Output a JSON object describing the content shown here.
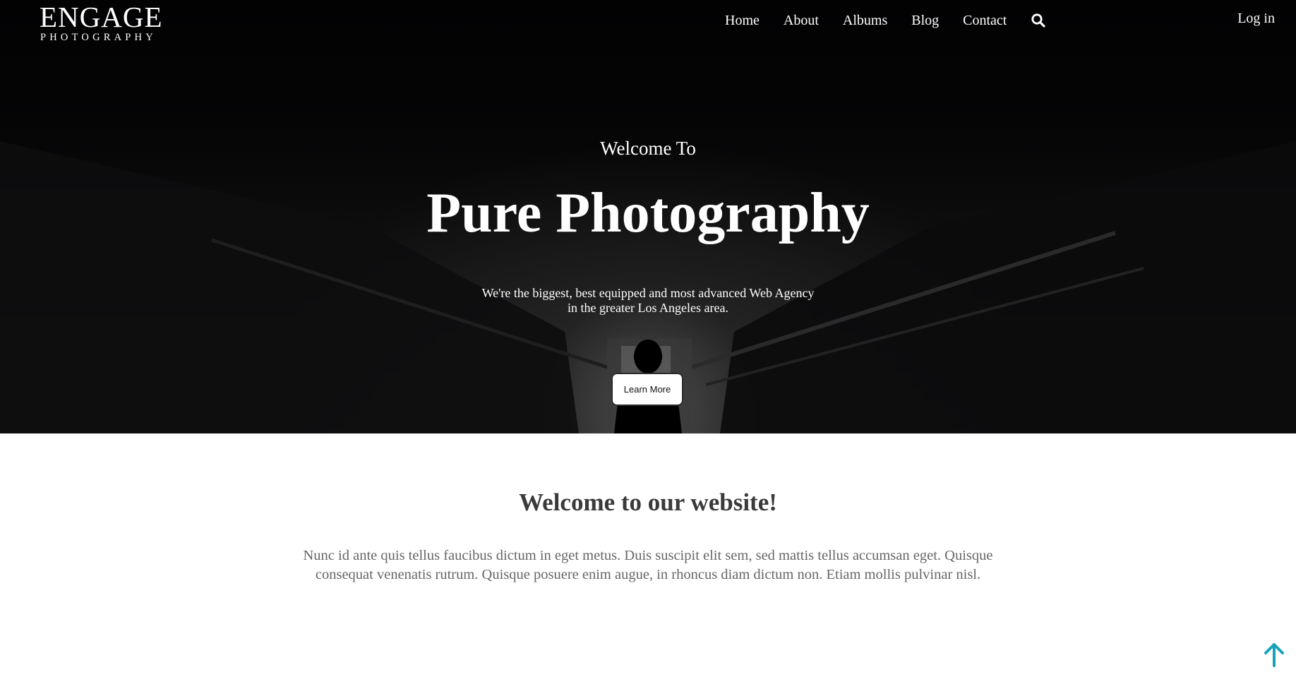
{
  "header": {
    "logo_main": "ENGAGE",
    "logo_sub": "PHOTOGRAPHY",
    "nav": [
      "Home",
      "About",
      "Albums",
      "Blog",
      "Contact"
    ],
    "search_icon": "search-icon",
    "login_label": "Log in"
  },
  "hero": {
    "eyebrow": "Welcome To",
    "title": "Pure Photography",
    "tagline_line1": "We're the biggest, best equipped and most advanced Web Agency",
    "tagline_line2": "in the greater Los Angeles area.",
    "cta_label": "Learn More"
  },
  "welcome": {
    "heading": "Welcome to our website!",
    "body": "Nunc id ante quis tellus faucibus dictum in eget metus. Duis suscipit elit sem, sed mattis tellus accumsan eget. Quisque consequat venenatis rutrum. Quisque posuere enim augue, in rhoncus diam dictum non. Etiam mollis pulvinar nisl."
  },
  "scroll_top": {
    "icon": "arrow-up-icon",
    "color": "#17a2b8"
  },
  "colors": {
    "hero_background": "#050506",
    "text_light": "#ffffff",
    "heading_dark": "#3a3a3a",
    "body_gray": "#666666"
  }
}
